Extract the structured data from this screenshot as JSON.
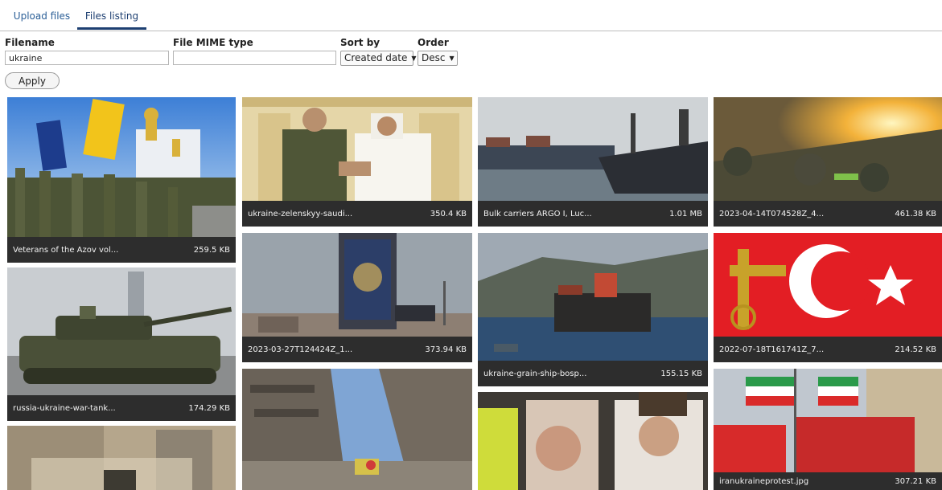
{
  "tabs": [
    {
      "label": "Upload files",
      "active": false
    },
    {
      "label": "Files listing",
      "active": true
    }
  ],
  "filters": {
    "filename": {
      "label": "Filename",
      "value": "ukraine"
    },
    "mime": {
      "label": "File MIME type",
      "value": ""
    },
    "sort_by": {
      "label": "Sort by",
      "value": "Created date"
    },
    "order": {
      "label": "Order",
      "value": "Desc"
    },
    "apply_label": "Apply"
  },
  "files": [
    {
      "name": "Veterans of the Azov vol...",
      "size": "259.5 KB"
    },
    {
      "name": "russia-ukraine-war-tank...",
      "size": "174.29 KB"
    },
    {
      "name": "",
      "size": ""
    },
    {
      "name": "ukraine-zelenskyy-saudi...",
      "size": "350.4 KB"
    },
    {
      "name": "2023-03-27T124424Z_1...",
      "size": "373.94 KB"
    },
    {
      "name": "",
      "size": ""
    },
    {
      "name": "Bulk carriers ARGO I, Luc...",
      "size": "1.01 MB"
    },
    {
      "name": "ukraine-grain-ship-bosp...",
      "size": "155.15 KB"
    },
    {
      "name": "",
      "size": ""
    },
    {
      "name": "2023-04-14T074528Z_4...",
      "size": "461.38 KB"
    },
    {
      "name": "2022-07-18T161741Z_7...",
      "size": "214.52 KB"
    },
    {
      "name": "iranukraineprotest.jpg",
      "size": "307.21 KB"
    }
  ],
  "colors": {
    "tab_text": "#2b5f97",
    "tab_active_underline": "#1d3f71",
    "caption_bg": "#2d2d2d",
    "caption_text": "#f2f2f2"
  }
}
